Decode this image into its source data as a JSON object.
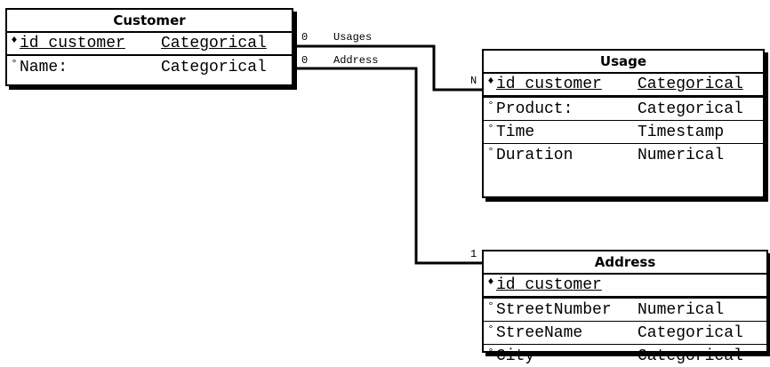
{
  "entities": {
    "customer": {
      "title": "Customer",
      "attributes": [
        {
          "marker": "♦",
          "name": "id_customer",
          "type": "Categorical",
          "key": true
        },
        {
          "marker": "°",
          "name": "Name:",
          "type": "Categorical",
          "key": false
        }
      ]
    },
    "usage": {
      "title": "Usage",
      "attributes": [
        {
          "marker": "♦",
          "name": "id_customer",
          "type": "Categorical",
          "key": true
        },
        {
          "marker": "°",
          "name": "Product:",
          "type": "Categorical",
          "key": false
        },
        {
          "marker": "°",
          "name": "Time",
          "type": "Timestamp",
          "key": false
        },
        {
          "marker": "°",
          "name": "Duration",
          "type": "Numerical",
          "key": false
        }
      ]
    },
    "address": {
      "title": "Address",
      "attributes": [
        {
          "marker": "♦",
          "name": "id_customer",
          "type": "",
          "key": true
        },
        {
          "marker": "°",
          "name": "StreetNumber",
          "type": "Numerical",
          "key": false
        },
        {
          "marker": "°",
          "name": "StreeName",
          "type": "Categorical",
          "key": false
        },
        {
          "marker": "°",
          "name": "City",
          "type": "Categorical",
          "key": false
        }
      ]
    }
  },
  "relationships": {
    "usages": {
      "label": "Usages",
      "from_card": "0",
      "to_card": "N"
    },
    "address": {
      "label": "Address",
      "from_card": "0",
      "to_card": "1"
    }
  }
}
